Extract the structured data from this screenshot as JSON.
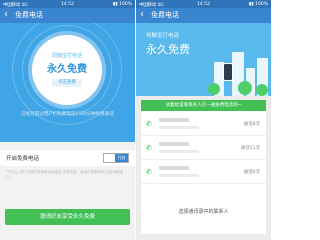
{
  "left": {
    "status": {
      "carrier": "中国移动 4G",
      "time": "14:52",
      "signal": "▮▮ 100%"
    },
    "header": {
      "back": "‹",
      "title": "免费电话"
    },
    "hero": {
      "sub": "周触宝打电话",
      "main": "永久免费",
      "tag": "点击查看",
      "promo": "已经有超过用户打免费电话1500分钟免费通话"
    },
    "toggle": {
      "label": "开启免费电话",
      "state_text": "开启"
    },
    "note": "*开启后,拨打电话时将使用免费通话,无需话费。通话时需要联网,流量消耗很少。",
    "cta": "邀请好友享受永久免费"
  },
  "right": {
    "status": {
      "carrier": "中国移动 4G",
      "time": "14:52",
      "signal": "▮▮ 100%"
    },
    "header": {
      "back": "‹",
      "title": "免费电话"
    },
    "hero": {
      "sub": "用触宝打电话",
      "main": "永久免费"
    },
    "banner": "试着给常联系的人打一通免费电话吧~",
    "contacts": [
      {
        "count": "通话8次"
      },
      {
        "count": "通话11次"
      },
      {
        "count": "通话6次"
      }
    ],
    "pick": "选择通讯录中的联系人"
  },
  "colors": {
    "blue": "#3a85cf",
    "sky": "#3fa5e6",
    "green": "#42c056"
  }
}
